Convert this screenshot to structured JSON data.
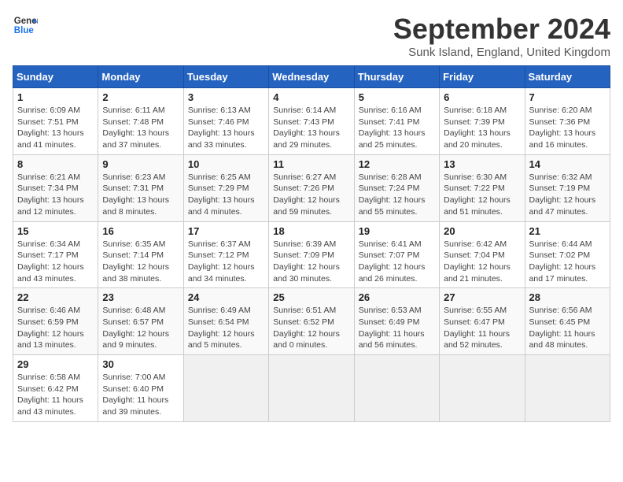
{
  "header": {
    "logo_line1": "General",
    "logo_line2": "Blue",
    "month_title": "September 2024",
    "subtitle": "Sunk Island, England, United Kingdom"
  },
  "weekdays": [
    "Sunday",
    "Monday",
    "Tuesday",
    "Wednesday",
    "Thursday",
    "Friday",
    "Saturday"
  ],
  "weeks": [
    [
      {
        "day": "1",
        "info": "Sunrise: 6:09 AM\nSunset: 7:51 PM\nDaylight: 13 hours\nand 41 minutes."
      },
      {
        "day": "2",
        "info": "Sunrise: 6:11 AM\nSunset: 7:48 PM\nDaylight: 13 hours\nand 37 minutes."
      },
      {
        "day": "3",
        "info": "Sunrise: 6:13 AM\nSunset: 7:46 PM\nDaylight: 13 hours\nand 33 minutes."
      },
      {
        "day": "4",
        "info": "Sunrise: 6:14 AM\nSunset: 7:43 PM\nDaylight: 13 hours\nand 29 minutes."
      },
      {
        "day": "5",
        "info": "Sunrise: 6:16 AM\nSunset: 7:41 PM\nDaylight: 13 hours\nand 25 minutes."
      },
      {
        "day": "6",
        "info": "Sunrise: 6:18 AM\nSunset: 7:39 PM\nDaylight: 13 hours\nand 20 minutes."
      },
      {
        "day": "7",
        "info": "Sunrise: 6:20 AM\nSunset: 7:36 PM\nDaylight: 13 hours\nand 16 minutes."
      }
    ],
    [
      {
        "day": "8",
        "info": "Sunrise: 6:21 AM\nSunset: 7:34 PM\nDaylight: 13 hours\nand 12 minutes."
      },
      {
        "day": "9",
        "info": "Sunrise: 6:23 AM\nSunset: 7:31 PM\nDaylight: 13 hours\nand 8 minutes."
      },
      {
        "day": "10",
        "info": "Sunrise: 6:25 AM\nSunset: 7:29 PM\nDaylight: 13 hours\nand 4 minutes."
      },
      {
        "day": "11",
        "info": "Sunrise: 6:27 AM\nSunset: 7:26 PM\nDaylight: 12 hours\nand 59 minutes."
      },
      {
        "day": "12",
        "info": "Sunrise: 6:28 AM\nSunset: 7:24 PM\nDaylight: 12 hours\nand 55 minutes."
      },
      {
        "day": "13",
        "info": "Sunrise: 6:30 AM\nSunset: 7:22 PM\nDaylight: 12 hours\nand 51 minutes."
      },
      {
        "day": "14",
        "info": "Sunrise: 6:32 AM\nSunset: 7:19 PM\nDaylight: 12 hours\nand 47 minutes."
      }
    ],
    [
      {
        "day": "15",
        "info": "Sunrise: 6:34 AM\nSunset: 7:17 PM\nDaylight: 12 hours\nand 43 minutes."
      },
      {
        "day": "16",
        "info": "Sunrise: 6:35 AM\nSunset: 7:14 PM\nDaylight: 12 hours\nand 38 minutes."
      },
      {
        "day": "17",
        "info": "Sunrise: 6:37 AM\nSunset: 7:12 PM\nDaylight: 12 hours\nand 34 minutes."
      },
      {
        "day": "18",
        "info": "Sunrise: 6:39 AM\nSunset: 7:09 PM\nDaylight: 12 hours\nand 30 minutes."
      },
      {
        "day": "19",
        "info": "Sunrise: 6:41 AM\nSunset: 7:07 PM\nDaylight: 12 hours\nand 26 minutes."
      },
      {
        "day": "20",
        "info": "Sunrise: 6:42 AM\nSunset: 7:04 PM\nDaylight: 12 hours\nand 21 minutes."
      },
      {
        "day": "21",
        "info": "Sunrise: 6:44 AM\nSunset: 7:02 PM\nDaylight: 12 hours\nand 17 minutes."
      }
    ],
    [
      {
        "day": "22",
        "info": "Sunrise: 6:46 AM\nSunset: 6:59 PM\nDaylight: 12 hours\nand 13 minutes."
      },
      {
        "day": "23",
        "info": "Sunrise: 6:48 AM\nSunset: 6:57 PM\nDaylight: 12 hours\nand 9 minutes."
      },
      {
        "day": "24",
        "info": "Sunrise: 6:49 AM\nSunset: 6:54 PM\nDaylight: 12 hours\nand 5 minutes."
      },
      {
        "day": "25",
        "info": "Sunrise: 6:51 AM\nSunset: 6:52 PM\nDaylight: 12 hours\nand 0 minutes."
      },
      {
        "day": "26",
        "info": "Sunrise: 6:53 AM\nSunset: 6:49 PM\nDaylight: 11 hours\nand 56 minutes."
      },
      {
        "day": "27",
        "info": "Sunrise: 6:55 AM\nSunset: 6:47 PM\nDaylight: 11 hours\nand 52 minutes."
      },
      {
        "day": "28",
        "info": "Sunrise: 6:56 AM\nSunset: 6:45 PM\nDaylight: 11 hours\nand 48 minutes."
      }
    ],
    [
      {
        "day": "29",
        "info": "Sunrise: 6:58 AM\nSunset: 6:42 PM\nDaylight: 11 hours\nand 43 minutes."
      },
      {
        "day": "30",
        "info": "Sunrise: 7:00 AM\nSunset: 6:40 PM\nDaylight: 11 hours\nand 39 minutes."
      },
      {
        "day": "",
        "info": ""
      },
      {
        "day": "",
        "info": ""
      },
      {
        "day": "",
        "info": ""
      },
      {
        "day": "",
        "info": ""
      },
      {
        "day": "",
        "info": ""
      }
    ]
  ]
}
